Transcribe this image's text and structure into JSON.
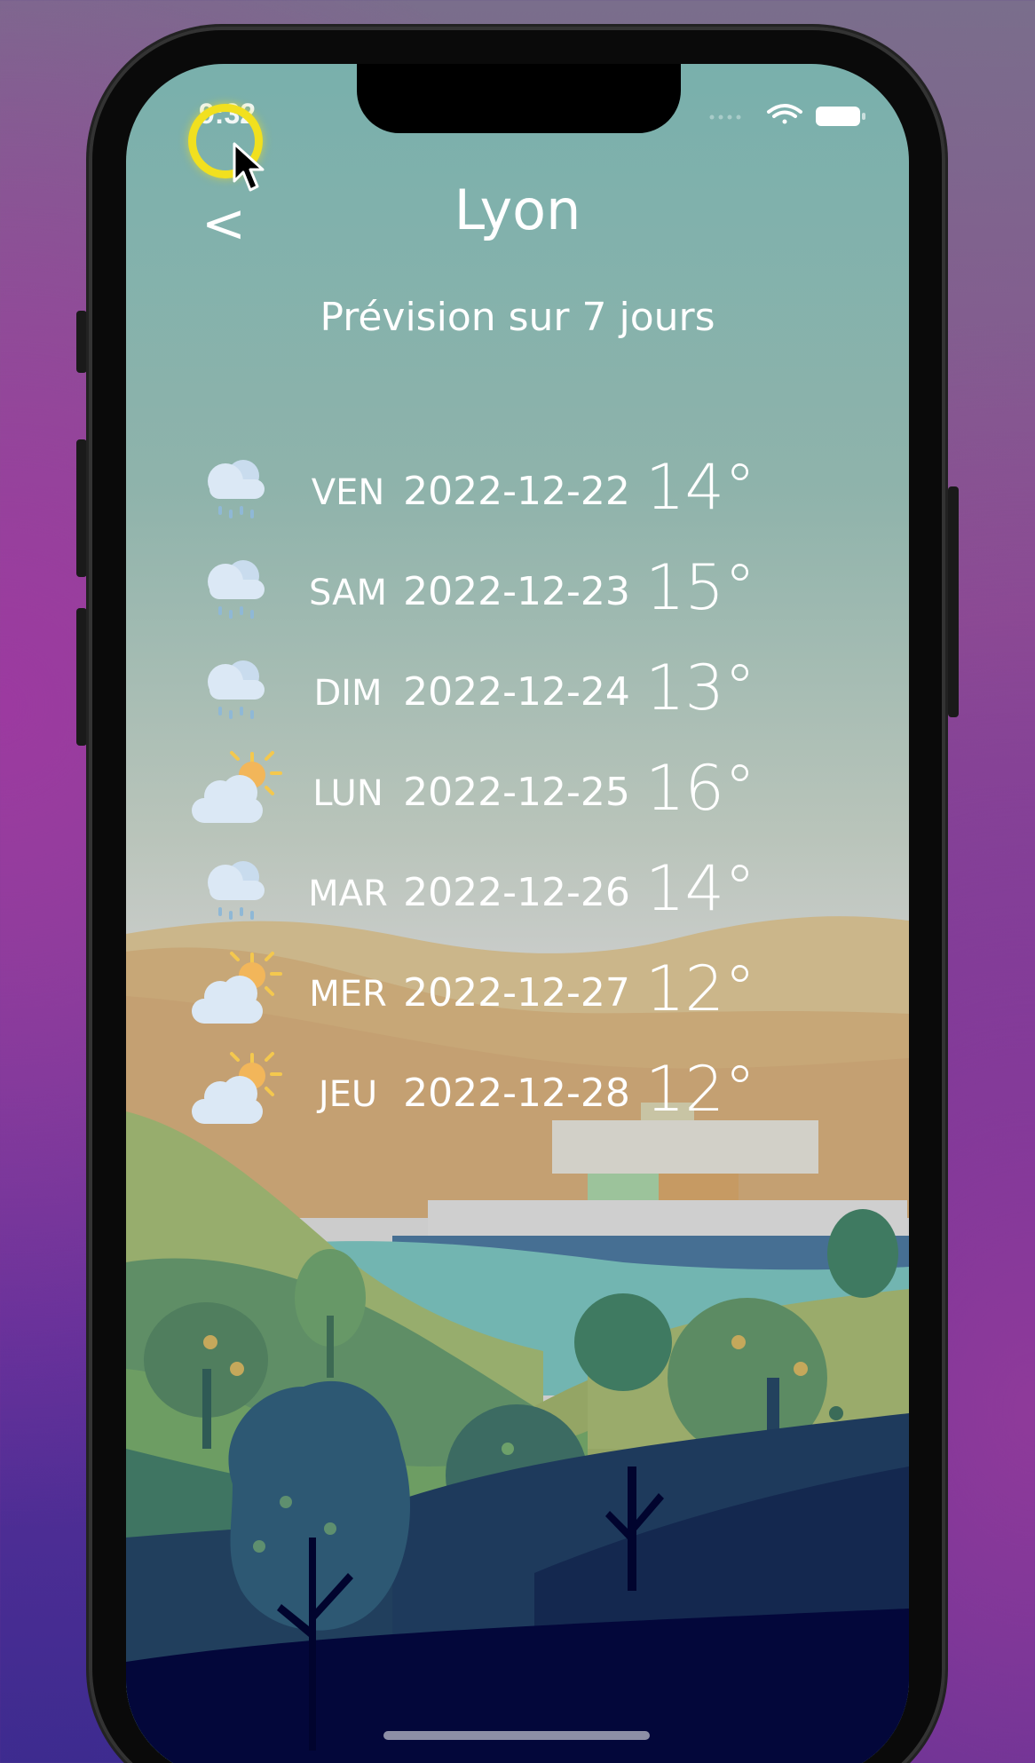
{
  "statusbar": {
    "time": "9:32"
  },
  "header": {
    "back_label": "<",
    "city": "Lyon"
  },
  "subtitle": "Prévision sur 7 jours",
  "forecast": [
    {
      "day": "VEN",
      "date": "2022-12-22",
      "temp": "14°",
      "icon": "rain-cloud-icon"
    },
    {
      "day": "SAM",
      "date": "2022-12-23",
      "temp": "15°",
      "icon": "rain-cloud-icon"
    },
    {
      "day": "DIM",
      "date": "2022-12-24",
      "temp": "13°",
      "icon": "rain-cloud-icon"
    },
    {
      "day": "LUN",
      "date": "2022-12-25",
      "temp": "16°",
      "icon": "partly-sunny-icon"
    },
    {
      "day": "MAR",
      "date": "2022-12-26",
      "temp": "14°",
      "icon": "rain-cloud-icon"
    },
    {
      "day": "MER",
      "date": "2022-12-27",
      "temp": "12°",
      "icon": "partly-sunny-icon"
    },
    {
      "day": "JEU",
      "date": "2022-12-28",
      "temp": "12°",
      "icon": "partly-sunny-icon"
    }
  ]
}
